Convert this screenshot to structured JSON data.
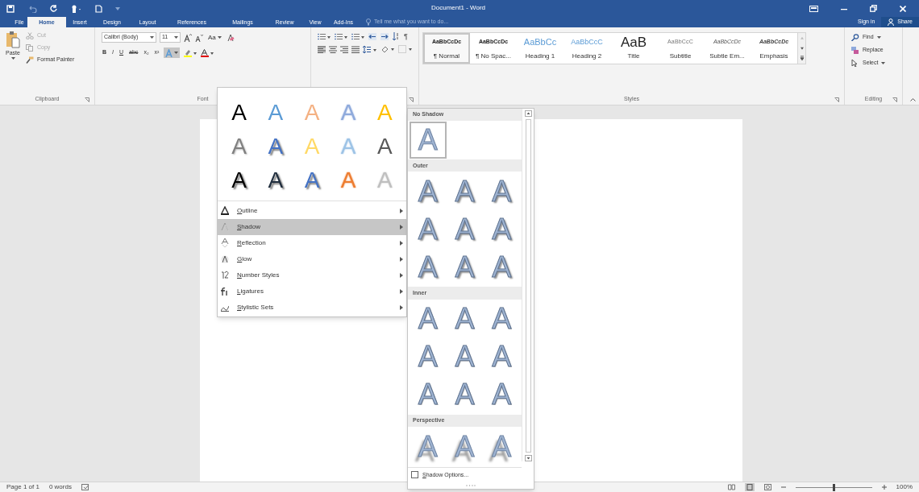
{
  "window": {
    "title": "Document1 - Word"
  },
  "tabs": [
    {
      "label": "File",
      "selected": false
    },
    {
      "label": "Home",
      "selected": true
    },
    {
      "label": "Insert",
      "selected": false
    },
    {
      "label": "Design",
      "selected": false
    },
    {
      "label": "Layout",
      "selected": false
    },
    {
      "label": "References",
      "selected": false
    },
    {
      "label": "Mailings",
      "selected": false
    },
    {
      "label": "Review",
      "selected": false
    },
    {
      "label": "View",
      "selected": false
    },
    {
      "label": "Add-Ins",
      "selected": false
    }
  ],
  "tell_me": {
    "placeholder": "Tell me what you want to do..."
  },
  "account": {
    "sign_in": "Sign in",
    "share": "Share"
  },
  "clipboard": {
    "paste": "Paste",
    "cut": "Cut",
    "copy": "Copy",
    "format_painter": "Format Painter",
    "label": "Clipboard"
  },
  "font": {
    "font_name": "Calibri (Body)",
    "font_size": "11",
    "change_case": "Aa",
    "format_buttons": [
      "B",
      "I",
      "U",
      "abc",
      "x₂",
      "x²"
    ],
    "text_effects_active": true,
    "label": "Font"
  },
  "paragraph": {
    "show_marks": "¶"
  },
  "styles": {
    "label": "Styles",
    "items": [
      {
        "preview": "AaBbCcDc",
        "name": "¶ Normal",
        "kind": "body",
        "selected": true
      },
      {
        "preview": "AaBbCcDc",
        "name": "¶ No Spac...",
        "kind": "body",
        "selected": false
      },
      {
        "preview": "AaBbCc",
        "name": "Heading 1",
        "kind": "heading1",
        "selected": false
      },
      {
        "preview": "AaBbCcC",
        "name": "Heading 2",
        "kind": "heading2",
        "selected": false
      },
      {
        "preview": "AaB",
        "name": "Title",
        "kind": "title",
        "selected": false
      },
      {
        "preview": "AaBbCcC",
        "name": "Subtitle",
        "kind": "subtitle",
        "selected": false
      },
      {
        "preview": "AaBbCcDc",
        "name": "Subtle Em...",
        "kind": "subtle",
        "selected": false
      },
      {
        "preview": "AaBbCcDc",
        "name": "Emphasis",
        "kind": "emphasis",
        "selected": false
      }
    ]
  },
  "editing": {
    "find": "Find",
    "replace": "Replace",
    "select": "Select",
    "label": "Editing"
  },
  "text_effects_menu": {
    "gallery": [
      {
        "letter": "A",
        "kind": "fill",
        "color": "#000000"
      },
      {
        "letter": "A",
        "kind": "fill",
        "color": "#5b9bd5"
      },
      {
        "letter": "A",
        "kind": "fill",
        "color": "#f4b183"
      },
      {
        "letter": "A",
        "kind": "outline",
        "color": "#8faadc"
      },
      {
        "letter": "A",
        "kind": "fill",
        "color": "#ffc000"
      },
      {
        "letter": "A",
        "kind": "light",
        "color": "#808080"
      },
      {
        "letter": "A",
        "kind": "shadow",
        "color": "#4472c4"
      },
      {
        "letter": "A",
        "kind": "fill",
        "color": "#ffd966"
      },
      {
        "letter": "A",
        "kind": "outline",
        "color": "#9dc3e6"
      },
      {
        "letter": "A",
        "kind": "fill",
        "color": "#595959"
      },
      {
        "letter": "A",
        "kind": "shadow",
        "color": "#000000"
      },
      {
        "letter": "A",
        "kind": "shadow",
        "color": "#1f2d3d"
      },
      {
        "letter": "A",
        "kind": "shadow",
        "color": "#4472c4"
      },
      {
        "letter": "A",
        "kind": "outline",
        "color": "#ed7d31"
      },
      {
        "letter": "A",
        "kind": "outline",
        "color": "#bfbfbf"
      }
    ],
    "items": [
      {
        "label": "Outline",
        "selected": false
      },
      {
        "label": "Shadow",
        "selected": true
      },
      {
        "label": "Reflection",
        "selected": false
      },
      {
        "label": "Glow",
        "selected": false
      },
      {
        "label": "Number Styles",
        "selected": false
      },
      {
        "label": "Ligatures",
        "selected": false
      },
      {
        "label": "Stylistic Sets",
        "selected": false
      }
    ]
  },
  "shadow_menu": {
    "sections": [
      {
        "title": "No Shadow",
        "kind": "none",
        "items": [
          {
            "letter": "A",
            "selected": true
          }
        ]
      },
      {
        "title": "Outer",
        "kind": "outer",
        "items": [
          {
            "letter": "A",
            "selected": false
          },
          {
            "letter": "A",
            "selected": false
          },
          {
            "letter": "A",
            "selected": false
          },
          {
            "letter": "A",
            "selected": false
          },
          {
            "letter": "A",
            "selected": false
          },
          {
            "letter": "A",
            "selected": false
          },
          {
            "letter": "A",
            "selected": false
          },
          {
            "letter": "A",
            "selected": false
          },
          {
            "letter": "A",
            "selected": false
          }
        ]
      },
      {
        "title": "Inner",
        "kind": "inner",
        "items": [
          {
            "letter": "A",
            "selected": false
          },
          {
            "letter": "A",
            "selected": false
          },
          {
            "letter": "A",
            "selected": false
          },
          {
            "letter": "A",
            "selected": false
          },
          {
            "letter": "A",
            "selected": false
          },
          {
            "letter": "A",
            "selected": false
          },
          {
            "letter": "A",
            "selected": false
          },
          {
            "letter": "A",
            "selected": false
          },
          {
            "letter": "A",
            "selected": false
          }
        ]
      },
      {
        "title": "Perspective",
        "kind": "perspective",
        "items": [
          {
            "letter": "A",
            "selected": false
          },
          {
            "letter": "A",
            "selected": false
          },
          {
            "letter": "A",
            "selected": false
          }
        ]
      }
    ],
    "options": {
      "label": "Shadow Options...",
      "checked": false
    }
  },
  "status_bar": {
    "page": "Page 1 of 1",
    "words": "0 words",
    "zoom": "100%",
    "level": 0.5
  }
}
